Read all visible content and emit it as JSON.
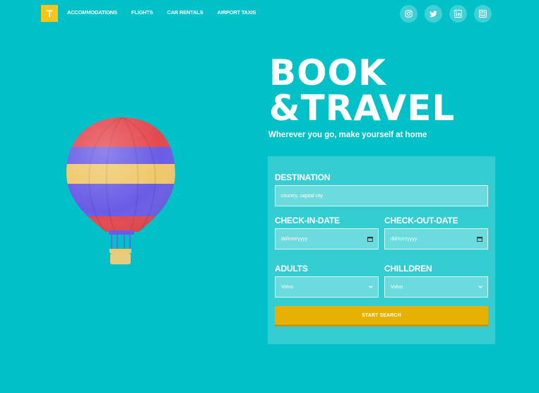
{
  "logo": {
    "letter": "T",
    "color": "#f5c518"
  },
  "nav": {
    "items": [
      "ACCOMMODATIONS",
      "FLIGHTS",
      "CAR RENTALS",
      "AIRPORT TAXIS"
    ]
  },
  "social": [
    "instagram-icon",
    "twitter-icon",
    "linkedin-icon",
    "bookmark-icon"
  ],
  "hero": {
    "title_line1": "BOOK",
    "title_line2": "&TRAVEL",
    "subtitle": "Wherever you go, make yourself at home"
  },
  "form": {
    "destination_label": "DESTINATION",
    "destination_placeholder": "country, capital city",
    "checkin_label": "CHECK-IN-DATE",
    "checkin_placeholder": "dd/mm/yyyy",
    "checkout_label": "CHECK-OUT-DATE",
    "checkout_placeholder": "dd/mm/yyyy",
    "adults_label": "ADULTS",
    "adults_value": "Volvo",
    "children_label": "CHILLDREN",
    "children_value": "Volvo",
    "search_button": "START SEARCH"
  },
  "colors": {
    "background": "#00c1c7",
    "button": "#e6b100",
    "accent_yellow": "#f5c518"
  }
}
